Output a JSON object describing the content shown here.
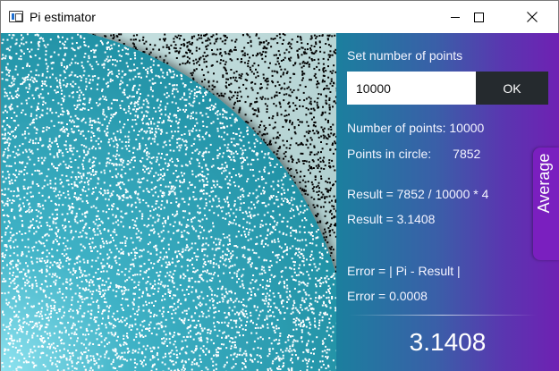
{
  "window": {
    "title": "Pi estimator",
    "icon": "app-window-icon",
    "controls": [
      "minimize-icon",
      "maximize-icon",
      "close-icon"
    ]
  },
  "panel": {
    "set_points_label": "Set number of points",
    "points_input_value": "10000",
    "ok_label": "OK",
    "number_of_points_label": "Number of points: 10000",
    "points_in_circle_label": "Points in circle:",
    "points_in_circle_value": "7852",
    "result_formula": "Result = 7852 / 10000 * 4",
    "result_value": "Result = 3.1408",
    "error_formula": "Error = | Pi - Result |",
    "error_value": "Error = 0.0008",
    "big_result": "3.1408",
    "average_tab": "Average"
  },
  "colors": {
    "circle_fill": "#2a9bb0",
    "outside_fill": "#b8d6d6",
    "inside_points": "#ffffff",
    "outside_points": "#000000",
    "panel_start": "#1b7f9e",
    "panel_end": "#6f21b3",
    "ok_button": "#252a2e",
    "average_tab": "#7a1fbf"
  }
}
